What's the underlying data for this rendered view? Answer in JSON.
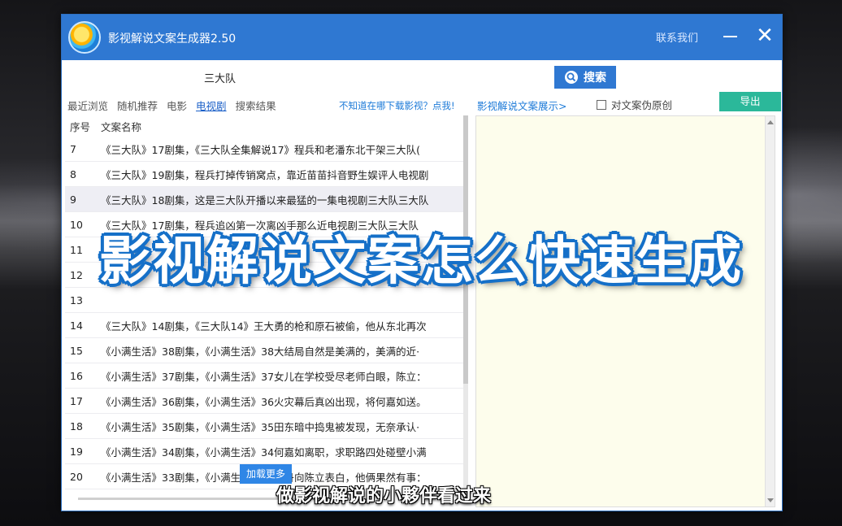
{
  "window": {
    "title": "影视解说文案生成器2.50",
    "contact": "联系我们",
    "close_glyph": "✕"
  },
  "search": {
    "value": "三大队",
    "button_label": "搜索"
  },
  "nav": {
    "items": [
      "最近浏览",
      "随机推荐",
      "电影",
      "电视剧",
      "搜索结果"
    ],
    "active": "电视剧",
    "download_hint": "不知道在哪下载影视？点我!"
  },
  "panel": {
    "title": "影视解说文案展示>",
    "checkbox_label": "对文案伪原创",
    "export_label": "导出"
  },
  "list": {
    "headers": [
      "序号",
      "文案名称"
    ],
    "rows": [
      {
        "no": "7",
        "name": "《三大队》17剧集，《三大队全集解说17》程兵和老潘东北干架三大队("
      },
      {
        "no": "8",
        "name": "《三大队》19剧集，程兵打掉传销窝点，靠近苗苗抖音野生娱评人电视剧"
      },
      {
        "no": "9",
        "name": "《三大队》18剧集，这是三大队开播以来最猛的一集电视剧三大队三大队"
      },
      {
        "no": "10",
        "name": "《三大队》17剧集，程兵追凶第一次离凶手那么近电视剧三大队三大队"
      },
      {
        "no": "11",
        "name": ""
      },
      {
        "no": "12",
        "name": ""
      },
      {
        "no": "13",
        "name": ""
      },
      {
        "no": "14",
        "name": "《三大队》14剧集，《三大队14》王大勇的枪和原石被偷，他从东北再次"
      },
      {
        "no": "15",
        "name": "《小满生活》38剧集，《小满生活》38大结局自然是美满的，美满的近·"
      },
      {
        "no": "16",
        "name": "《小满生活》37剧集，《小满生活》37女儿在学校受尽老师白眼，陈立："
      },
      {
        "no": "17",
        "name": "《小满生活》36剧集，《小满生活》36火灾幕后真凶出现，将何嘉如送。"
      },
      {
        "no": "18",
        "name": "《小满生活》35剧集，《小满生活》35田东暗中捣鬼被发现，无奈承认·"
      },
      {
        "no": "19",
        "name": "《小满生活》34剧集，《小满生活》34何嘉如离职，求职路四处碰壁小满"
      },
      {
        "no": "20",
        "name": "《小满生活》33剧集，《小满生活》33冯丹向陈立表白，他俩果然有事："
      }
    ],
    "highlighted_index": 2,
    "load_more": "加载更多"
  },
  "overlay": {
    "title": "影视解说文案怎么快速生成",
    "subtitle": "做影视解说的小夥伴看过来"
  }
}
